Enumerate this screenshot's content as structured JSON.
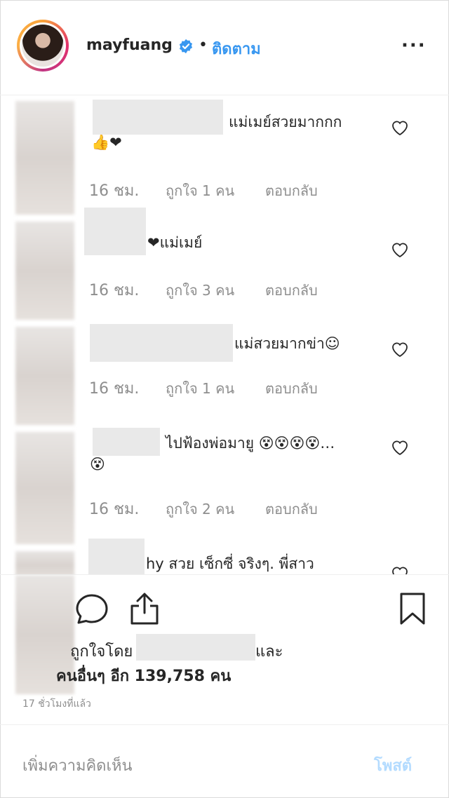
{
  "header": {
    "username": "mayfuang",
    "separator": "•",
    "follow_label": "ติดตาม",
    "more_label": "···"
  },
  "comments": [
    {
      "text": "แม่เมย์สวยมากกก",
      "text2": "👍❤",
      "time": "16 ชม.",
      "likes": "ถูกใจ 1 คน",
      "reply": "ตอบกลับ"
    },
    {
      "text": "❤แม่เมย์",
      "time": "16 ชม.",
      "likes": "ถูกใจ 3 คน",
      "reply": "ตอบกลับ"
    },
    {
      "text": "แม่สวยมากข่า☺",
      "time": "16 ชม.",
      "likes": "ถูกใจ 1 คน",
      "reply": "ตอบกลับ"
    },
    {
      "text": "ไปฟ้องพ่อมายู 😵😵😵😵…",
      "text2": "😵",
      "time": "16 ชม.",
      "likes": "ถูกใจ 2 คน",
      "reply": "ตอบกลับ"
    },
    {
      "text": "hy สวย เซ็กซี่ จริงๆ. พี่สาว"
    }
  ],
  "liked_by": {
    "prefix": "ถูกใจโดย",
    "and": "และ",
    "others": "คนอื่นๆ อีก 139,758 คน"
  },
  "posted_time": "17 ชั่วโมงที่แล้ว",
  "add_comment": {
    "placeholder": "เพิ่มความคิดเห็น",
    "post_label": "โพสต์"
  },
  "colors": {
    "accent": "#3897f0",
    "muted": "#8e8e8e",
    "post_disabled": "#b3dbff"
  }
}
